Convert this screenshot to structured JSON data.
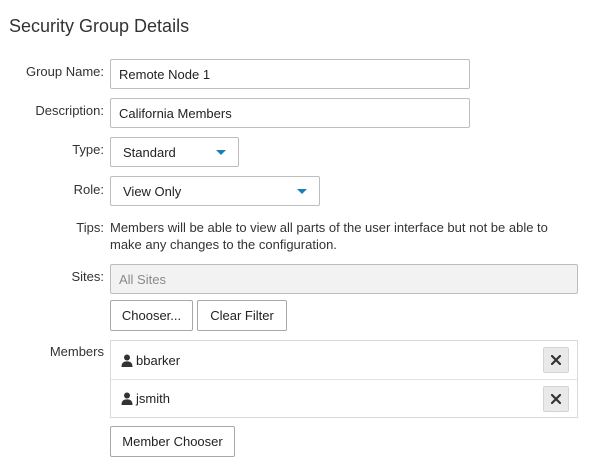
{
  "page": {
    "title": "Security Group Details"
  },
  "form": {
    "group_name": {
      "label": "Group Name:",
      "value": "Remote Node 1"
    },
    "description": {
      "label": "Description:",
      "value": "California Members"
    },
    "type": {
      "label": "Type:",
      "value": "Standard"
    },
    "role": {
      "label": "Role:",
      "value": "View Only"
    },
    "tips": {
      "label": "Tips:",
      "text": "Members will be able to view all parts of the user interface but not be able to make any changes to the configuration."
    },
    "sites": {
      "label": "Sites:",
      "placeholder": "All Sites",
      "chooser_label": "Chooser...",
      "clear_filter_label": "Clear Filter"
    },
    "members": {
      "label": "Members",
      "items": [
        {
          "name": "bbarker"
        },
        {
          "name": "jsmith"
        }
      ],
      "chooser_label": "Member Chooser"
    }
  },
  "colors": {
    "accent": "#1a7fb5"
  },
  "icons": {
    "member": "user-icon",
    "remove": "close-icon",
    "dropdown": "chevron-down-icon"
  }
}
